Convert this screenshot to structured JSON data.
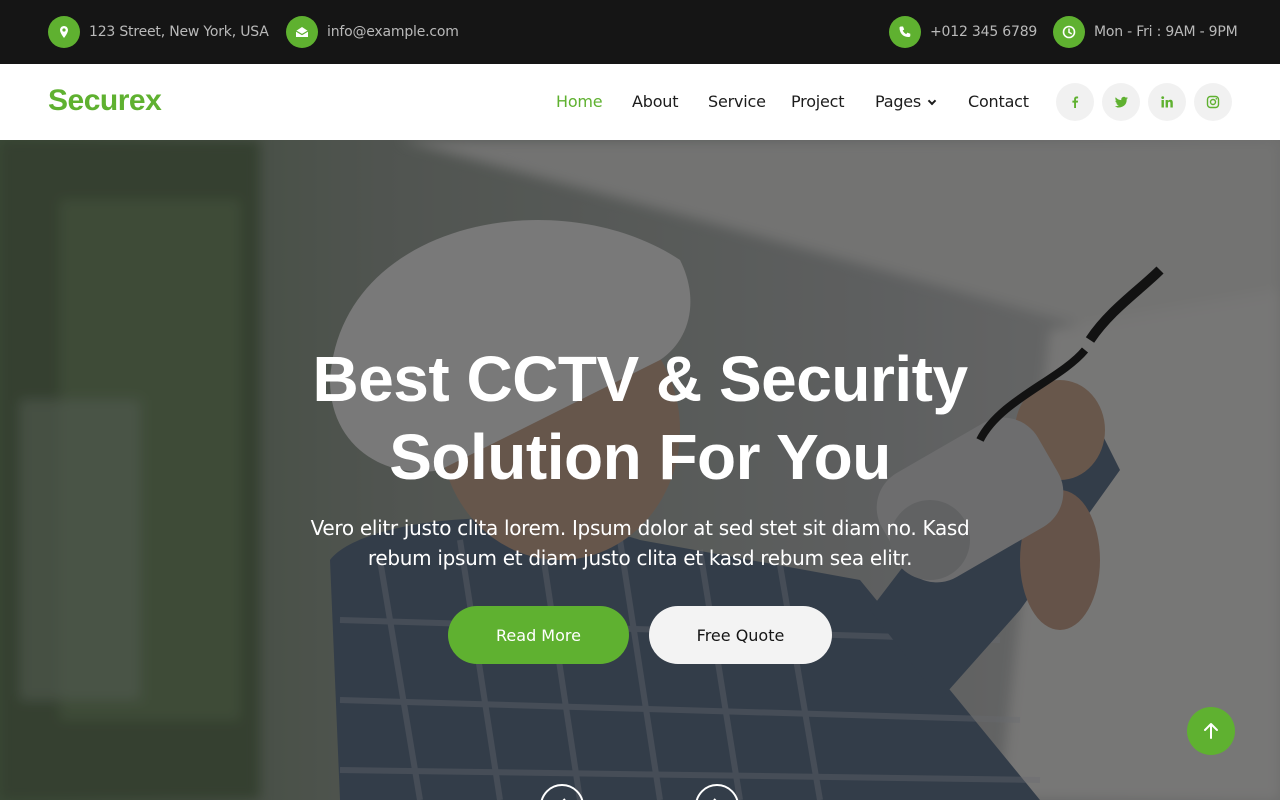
{
  "topbar": {
    "address": "123 Street, New York, USA",
    "email": "info@example.com",
    "phone": "+012 345 6789",
    "hours": "Mon - Fri : 9AM - 9PM",
    "icons": [
      "map-marker-icon",
      "envelope-open-icon",
      "phone-icon",
      "clock-icon"
    ]
  },
  "nav": {
    "brand": "Securex",
    "links": [
      "Home",
      "About",
      "Service",
      "Project",
      "Pages",
      "Contact"
    ],
    "active": "Home",
    "social": [
      "facebook-icon",
      "twitter-icon",
      "linkedin-icon",
      "instagram-icon"
    ]
  },
  "hero": {
    "title_line1": "Best CCTV & Security",
    "title_line2": "Solution For You",
    "subtitle": "Vero elitr justo clita lorem. Ipsum dolor at sed stet sit diam no. Kasd rebum ipsum et diam justo clita et kasd rebum sea elitr.",
    "read_more": "Read More",
    "free_quote": "Free Quote"
  },
  "colors": {
    "accent": "#5fb130",
    "topbar_bg": "#151515",
    "topbar_text": "#b9b9b9",
    "nav_text": "#1c1c1c",
    "light_button": "#f3f3f3"
  }
}
